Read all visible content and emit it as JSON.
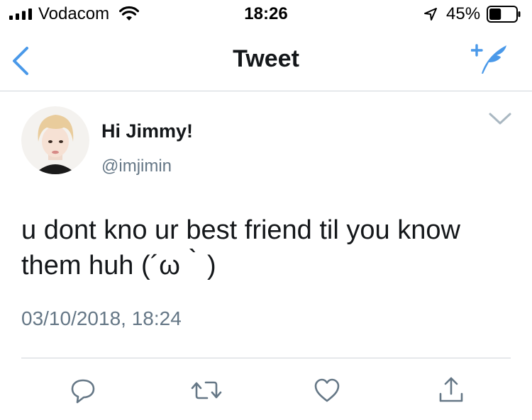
{
  "status_bar": {
    "carrier": "Vodacom",
    "time": "18:26",
    "battery": "45%",
    "battery_level": 0.45
  },
  "nav": {
    "title": "Tweet",
    "back_icon": "chevron-left-icon",
    "compose_icon": "compose-tweet-icon"
  },
  "tweet": {
    "author_name": "Hi Jimmy!",
    "author_handle": "@imjimin",
    "text_line1": "u dont kno ur best friend til you know",
    "text_line2": "them huh (´ω｀)",
    "timestamp": "03/10/2018, 18:24"
  },
  "actions": [
    {
      "icon": "reply-icon"
    },
    {
      "icon": "retweet-icon"
    },
    {
      "icon": "like-icon"
    },
    {
      "icon": "share-icon"
    }
  ],
  "colors": {
    "accent": "#4a99e9",
    "text": "#14171a",
    "secondary_text": "#657786",
    "divider": "#cfd4d9",
    "icon_gray": "#657786"
  }
}
